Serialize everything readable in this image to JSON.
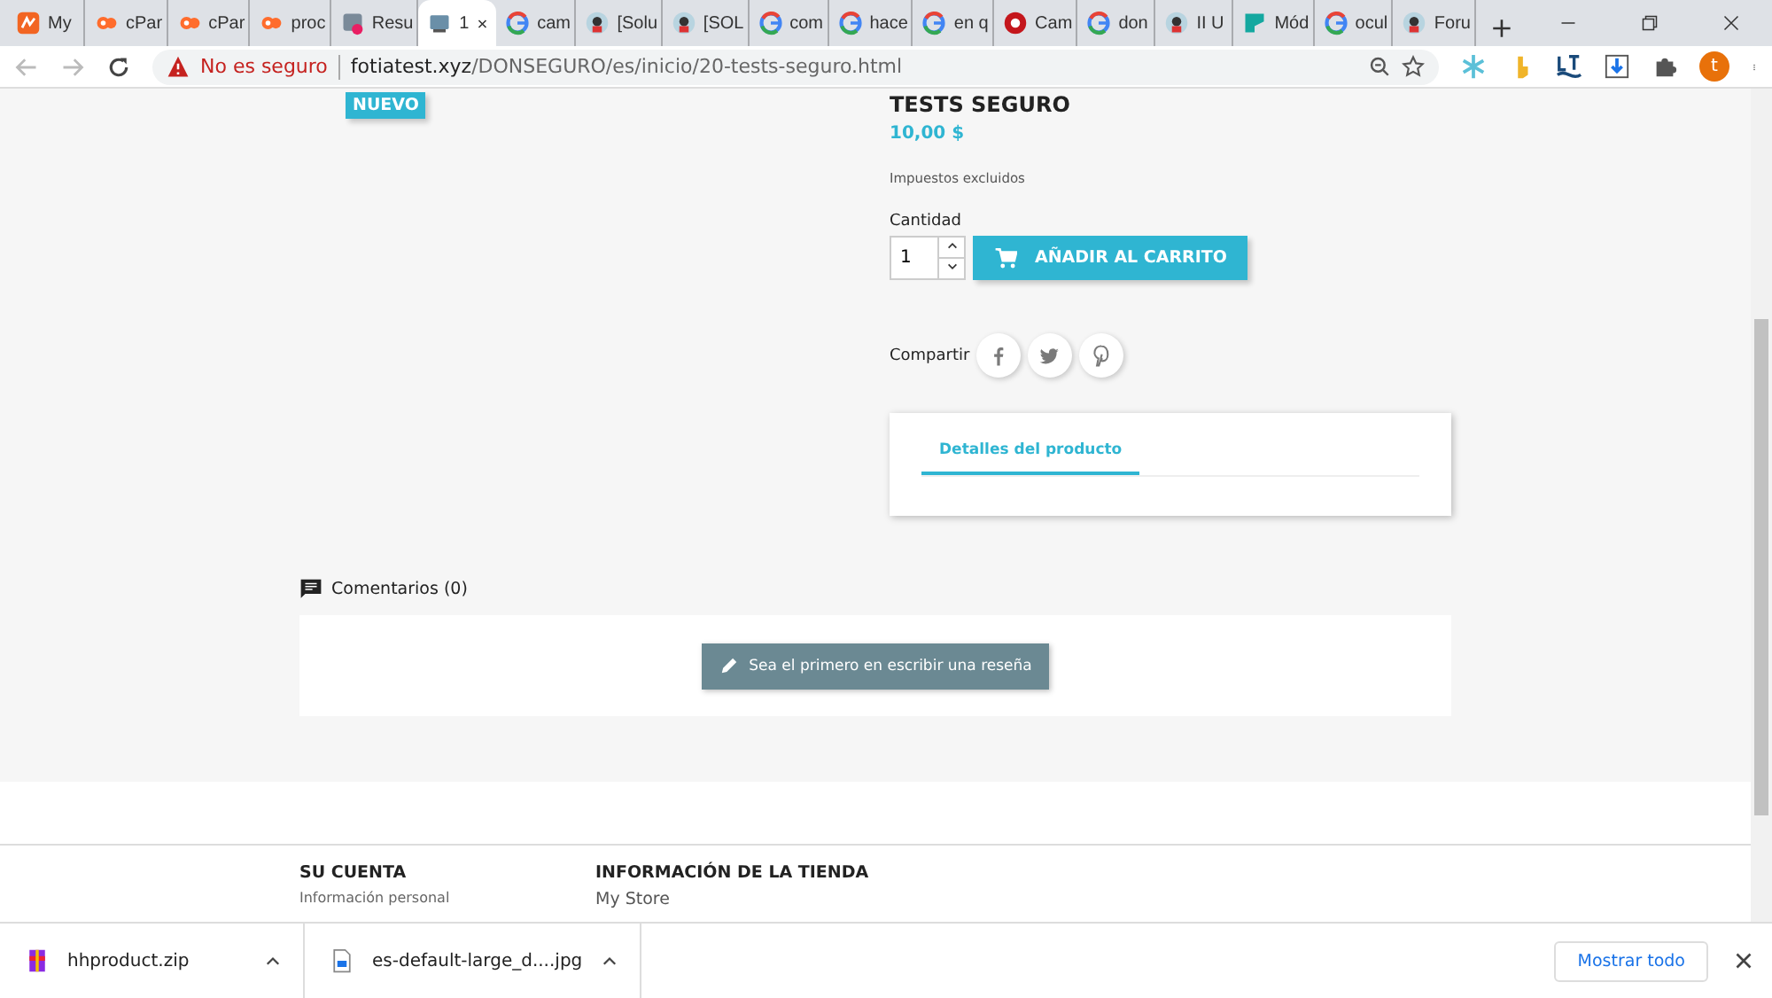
{
  "tabs": [
    {
      "title": "My",
      "kind": "orange",
      "selected": false
    },
    {
      "title": "cPar",
      "kind": "cpanel",
      "selected": false
    },
    {
      "title": "cPar",
      "kind": "cpanel",
      "selected": false
    },
    {
      "title": "proc",
      "kind": "cpanel",
      "selected": false
    },
    {
      "title": "Resu",
      "kind": "badge",
      "selected": false
    },
    {
      "title": "1",
      "kind": "page",
      "selected": true
    },
    {
      "title": "cam",
      "kind": "google",
      "selected": false
    },
    {
      "title": "[Solu",
      "kind": "avatar",
      "selected": false
    },
    {
      "title": "[SOL",
      "kind": "avatar",
      "selected": false
    },
    {
      "title": "com",
      "kind": "google",
      "selected": false
    },
    {
      "title": "hace",
      "kind": "google",
      "selected": false
    },
    {
      "title": "en q",
      "kind": "google",
      "selected": false
    },
    {
      "title": "Cam",
      "kind": "red",
      "selected": false
    },
    {
      "title": "don",
      "kind": "google",
      "selected": false
    },
    {
      "title": "II U",
      "kind": "avatar",
      "selected": false
    },
    {
      "title": "Mód",
      "kind": "teal",
      "selected": false
    },
    {
      "title": "ocul",
      "kind": "google",
      "selected": false
    },
    {
      "title": "Foru",
      "kind": "avatar",
      "selected": false
    }
  ],
  "address_bar": {
    "security": "No es seguro",
    "url_host": "fotiatest.xyz",
    "url_path": "/DONSEGURO/es/inicio/20-tests-seguro.html",
    "profile_initial": "t"
  },
  "product": {
    "badge": "NUEVO",
    "title": "TESTS SEGURO",
    "price": "10,00 $",
    "tax_note": "Impuestos excluidos",
    "quantity_label": "Cantidad",
    "quantity": "1",
    "add_to_cart": "AÑADIR AL CARRITO",
    "share_label": "Compartir",
    "details_tabs": [
      {
        "label": "Detalles del producto",
        "selected": true
      }
    ]
  },
  "comments": {
    "heading": "Comentarios (0)",
    "write_review": "Sea el primero en escribir una reseña"
  },
  "footer": {
    "columns": [
      {
        "heading": "SU CUENTA",
        "links": [
          "Información personal"
        ]
      },
      {
        "heading": "INFORMACIÓN DE LA TIENDA",
        "links": [
          "My Store"
        ]
      }
    ]
  },
  "downloads": {
    "items": [
      {
        "name": "hhproduct.zip",
        "kind": "archive"
      },
      {
        "name": "es-default-large_d....jpg",
        "kind": "image"
      }
    ],
    "show_all": "Mostrar todo"
  }
}
